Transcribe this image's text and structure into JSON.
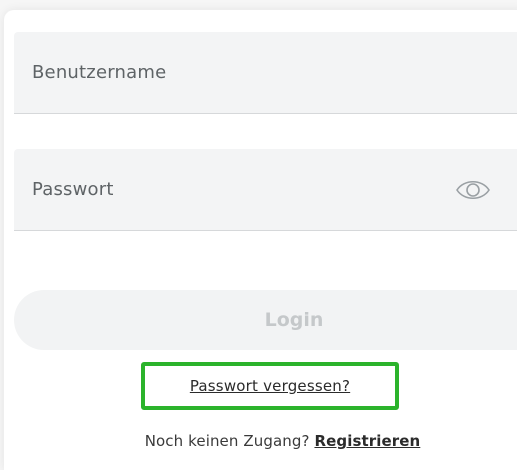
{
  "form": {
    "username_placeholder": "Benutzername",
    "password_placeholder": "Passwort",
    "login_label": "Login",
    "forgot_password_label": "Passwort vergessen?",
    "signup_prompt": "Noch keinen Zugang?",
    "signup_link": "Registrieren"
  },
  "colors": {
    "highlight_border": "#2bb32b",
    "field_background": "#f3f4f5",
    "login_disabled_text": "#c5c8ca"
  },
  "icons": {
    "password_toggle": "eye-icon"
  }
}
